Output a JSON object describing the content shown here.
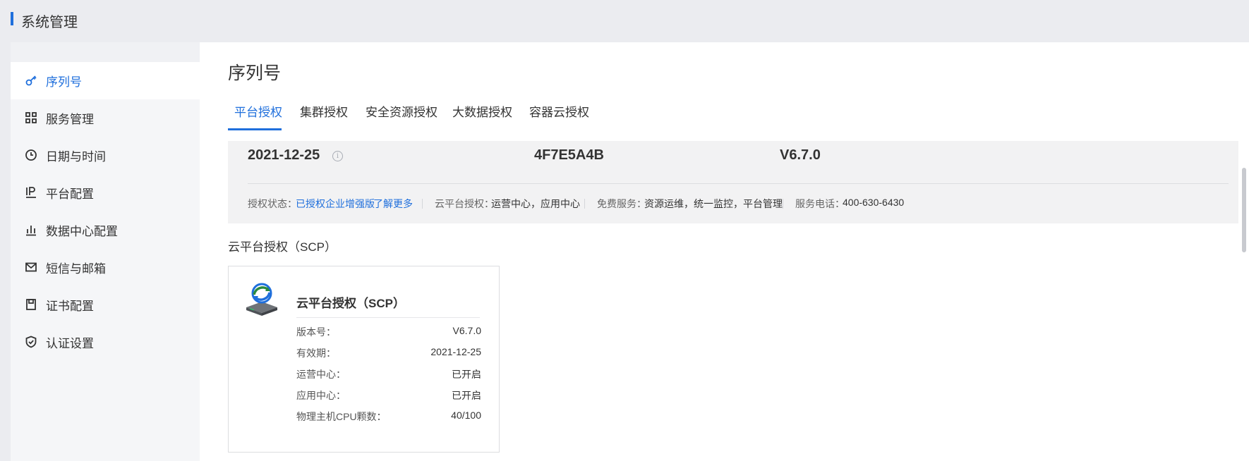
{
  "header": {
    "title": "系统管理"
  },
  "sidebar": {
    "items": [
      {
        "label": "序列号",
        "icon": "key-icon",
        "active": true
      },
      {
        "label": "服务管理",
        "icon": "grid-icon",
        "active": false
      },
      {
        "label": "日期与时间",
        "icon": "clock-icon",
        "active": false
      },
      {
        "label": "平台配置",
        "icon": "ip-icon",
        "active": false
      },
      {
        "label": "数据中心配置",
        "icon": "bar-chart-icon",
        "active": false
      },
      {
        "label": "短信与邮箱",
        "icon": "mail-icon",
        "active": false
      },
      {
        "label": "证书配置",
        "icon": "certificate-icon",
        "active": false
      },
      {
        "label": "认证设置",
        "icon": "shield-icon",
        "active": false
      }
    ]
  },
  "main": {
    "title": "序列号",
    "tabs": [
      {
        "label": "平台授权",
        "active": true
      },
      {
        "label": "集群授权",
        "active": false
      },
      {
        "label": "安全资源授权",
        "active": false
      },
      {
        "label": "大数据授权",
        "active": false
      },
      {
        "label": "容器云授权",
        "active": false
      }
    ],
    "info": {
      "expire_date": "2021-12-25",
      "serial": "4F7E5A4B",
      "version": "V6.7.0",
      "status_label": "授权状态：",
      "status_value": "已授权企业增强版",
      "learn_more": "了解更多",
      "cloud_label": "云平台授权：",
      "cloud_value": "运营中心，应用中心",
      "free_label": "免费服务：",
      "free_value": "资源运维，统一监控，平台管理",
      "phone_label": "服务电话：",
      "phone_value": "400-630-6430"
    },
    "section_title": "云平台授权（SCP）",
    "card": {
      "name": "云平台授权（SCP）",
      "rows": [
        {
          "label": "版本号：",
          "value": "V6.7.0"
        },
        {
          "label": "有效期：",
          "value": "2021-12-25"
        },
        {
          "label": "运营中心：",
          "value": "已开启"
        },
        {
          "label": "应用中心：",
          "value": "已开启"
        },
        {
          "label": "物理主机CPU颗数：",
          "value": "40/100"
        }
      ]
    }
  },
  "colors": {
    "accent": "#1f6fdc",
    "page_bg": "#ebecf0",
    "panel_bg": "#f2f2f3"
  }
}
